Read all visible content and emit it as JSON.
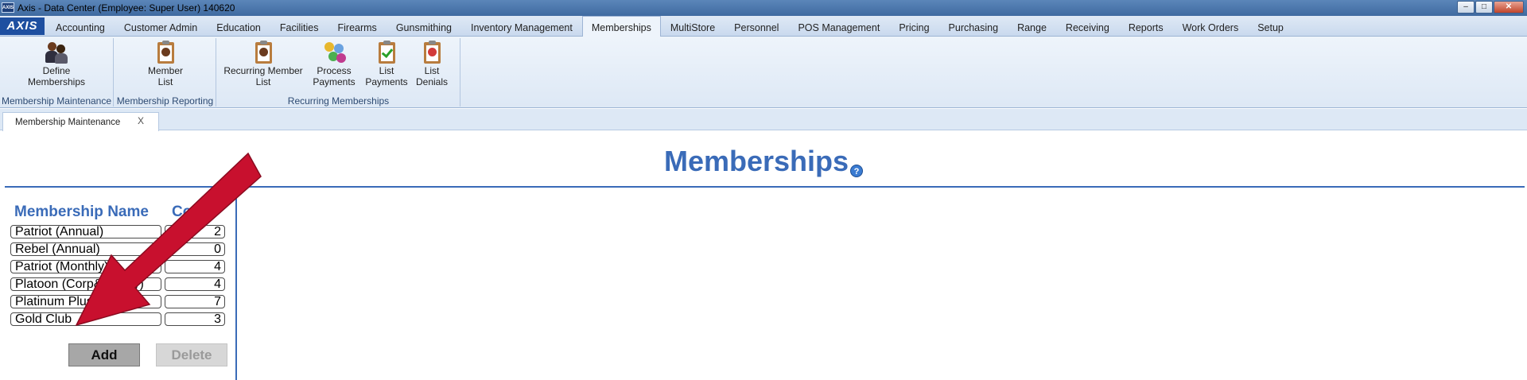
{
  "window": {
    "title": "Axis - Data Center  (Employee: Super User) 140620",
    "app_icon_text": "AXIS",
    "controls": {
      "minimize": "–",
      "maximize": "□",
      "close": "✕"
    }
  },
  "menubar": {
    "logo": "AXIS",
    "tabs": [
      {
        "label": "Accounting"
      },
      {
        "label": "Customer Admin"
      },
      {
        "label": "Education"
      },
      {
        "label": "Facilities"
      },
      {
        "label": "Firearms"
      },
      {
        "label": "Gunsmithing"
      },
      {
        "label": "Inventory Management"
      },
      {
        "label": "Memberships",
        "active": true
      },
      {
        "label": "MultiStore"
      },
      {
        "label": "Personnel"
      },
      {
        "label": "POS Management"
      },
      {
        "label": "Pricing"
      },
      {
        "label": "Purchasing"
      },
      {
        "label": "Range"
      },
      {
        "label": "Receiving"
      },
      {
        "label": "Reports"
      },
      {
        "label": "Work Orders"
      },
      {
        "label": "Setup"
      }
    ]
  },
  "ribbon": {
    "groups": [
      {
        "label": "Membership Maintenance",
        "buttons": [
          {
            "label": "Define\nMemberships",
            "icon": "people-icon"
          }
        ]
      },
      {
        "label": "Membership Reporting",
        "buttons": [
          {
            "label": "Member\nList",
            "icon": "clipboard-person-icon"
          }
        ]
      },
      {
        "label": "Recurring Memberships",
        "buttons": [
          {
            "label": "Recurring Member\nList",
            "icon": "clipboard-person-icon"
          },
          {
            "label": "Process\nPayments",
            "icon": "money-icon"
          },
          {
            "label": "List\nPayments",
            "icon": "clipboard-check-icon"
          },
          {
            "label": "List\nDenials",
            "icon": "clipboard-x-icon"
          }
        ]
      }
    ]
  },
  "doc_tabs": [
    {
      "label": "Membership Maintenance",
      "close": "X"
    }
  ],
  "main": {
    "title": "Memberships",
    "help": "?",
    "columns": {
      "name": "Membership Name",
      "count": "Co"
    },
    "rows": [
      {
        "name": "Patriot (Annual)",
        "count": "2"
      },
      {
        "name": "Rebel (Annual)",
        "count": "0"
      },
      {
        "name": "Patriot (Monthly)",
        "count": "4"
      },
      {
        "name": "Platoon (Corp&Family)",
        "count": "4"
      },
      {
        "name": "Platinum Plus",
        "count": "7"
      },
      {
        "name": "Gold Club",
        "count": "3"
      }
    ],
    "buttons": {
      "add": "Add",
      "delete": "Delete"
    }
  },
  "colors": {
    "accent": "#3a6bb8",
    "arrow": "#c8102e"
  }
}
